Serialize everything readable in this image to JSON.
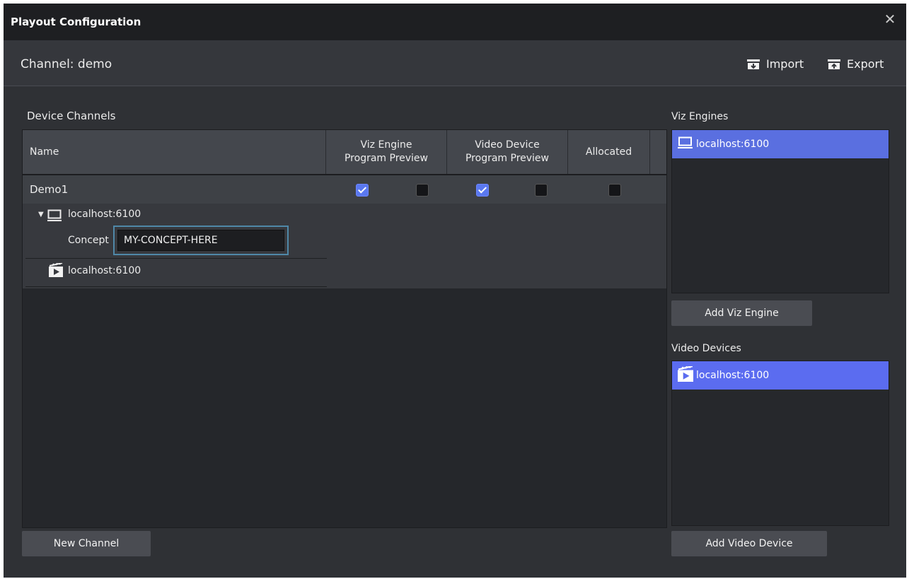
{
  "window": {
    "title": "Playout Configuration",
    "close_icon": "close-icon"
  },
  "header": {
    "channel_label": "Channel: demo",
    "import_label": "Import",
    "export_label": "Export"
  },
  "device_channels": {
    "section_label": "Device Channels",
    "columns": {
      "name": "Name",
      "viz_engine_line1": "Viz Engine",
      "viz_engine_line2": "Program Preview",
      "video_device_line1": "Video Device",
      "video_device_line2": "Program Preview",
      "allocated": "Allocated"
    },
    "rows": [
      {
        "name": "Demo1",
        "viz_program": true,
        "viz_preview": false,
        "video_program": true,
        "video_preview": false,
        "allocated": false
      }
    ],
    "tree": {
      "engine_label": "localhost:6100",
      "concept_label": "Concept",
      "concept_value": "MY-CONCEPT-HERE",
      "video_label": "localhost:6100"
    },
    "new_channel_button": "New Channel"
  },
  "viz_engines": {
    "section_label": "Viz Engines",
    "items": [
      {
        "label": "localhost:6100",
        "selected": true
      }
    ],
    "add_button": "Add Viz Engine"
  },
  "video_devices": {
    "section_label": "Video Devices",
    "items": [
      {
        "label": "localhost:6100",
        "selected": true
      }
    ],
    "add_button": "Add Video Device"
  },
  "colors": {
    "selection_blue": "#5a6fe0",
    "checkbox_checked": "#5a78f0",
    "focus_outline": "#4f88a8",
    "background": "#2f3135"
  }
}
